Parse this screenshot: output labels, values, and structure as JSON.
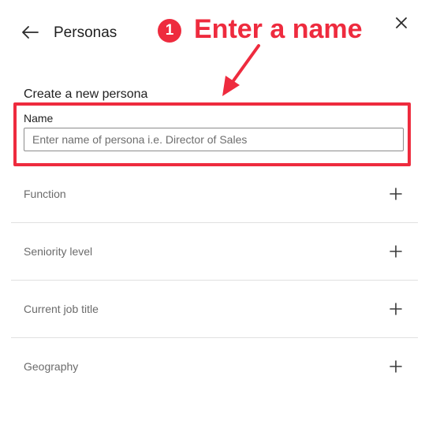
{
  "header": {
    "title": "Personas"
  },
  "callout": {
    "step_number": "1",
    "text": "Enter a name",
    "color": "#ee2b3e"
  },
  "form": {
    "section_heading": "Create a new persona",
    "name": {
      "label": "Name",
      "value": "",
      "placeholder": "Enter name of persona i.e. Director of Sales"
    },
    "fields": [
      {
        "label": "Function"
      },
      {
        "label": "Seniority level"
      },
      {
        "label": "Current job title"
      },
      {
        "label": "Geography"
      }
    ]
  },
  "icons": {
    "back": "arrow-left-icon",
    "close": "close-icon",
    "expand": "plus-icon"
  }
}
